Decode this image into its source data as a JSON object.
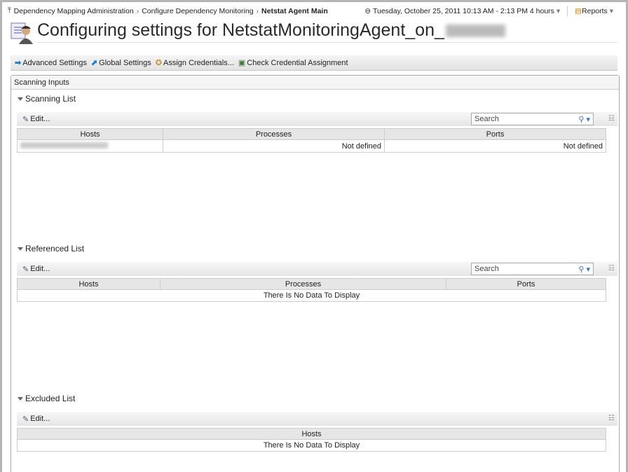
{
  "breadcrumb": {
    "items": [
      "Dependency Mapping Administration",
      "Configure Dependency Monitoring"
    ],
    "current": "Netstat Agent Main"
  },
  "timerange": "Tuesday, October 25, 2011 10:13 AM - 2:13 PM 4 hours",
  "reports": "Reports",
  "title": "Configuring settings for NetstatMonitoringAgent_on_",
  "toolbar": {
    "advanced": "Advanced Settings",
    "global": "Global Settings",
    "assign": "Assign Credentials...",
    "check": "Check Credential Assignment"
  },
  "panel_title": "Scanning Inputs",
  "edit": "Edit...",
  "search_placeholder": "Search",
  "scanning": {
    "title": "Scanning List",
    "columns": [
      "Hosts",
      "Processes",
      "Ports"
    ],
    "rows": [
      {
        "processes": "Not defined",
        "ports": "Not defined"
      }
    ]
  },
  "referenced": {
    "title": "Referenced List",
    "columns": [
      "Hosts",
      "Processes",
      "Ports"
    ],
    "empty": "There Is No Data To Display"
  },
  "excluded": {
    "title": "Excluded List",
    "columns": [
      "Hosts"
    ],
    "empty": "There Is No Data To Display"
  }
}
